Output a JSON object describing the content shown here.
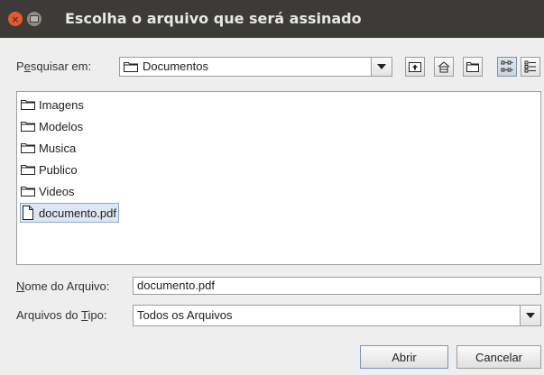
{
  "window": {
    "title": "Escolha o arquivo que será assinado"
  },
  "toolbar": {
    "look_in_label_u": "e",
    "look_in_label_pre": "P",
    "look_in_label_post": "squisar em:",
    "look_in_value": "Documentos",
    "buttons": [
      "up-folder",
      "home",
      "new-folder",
      "list-view",
      "details-view"
    ]
  },
  "files": [
    {
      "name": "Imagens",
      "type": "folder"
    },
    {
      "name": "Modelos",
      "type": "folder"
    },
    {
      "name": "Musica",
      "type": "folder"
    },
    {
      "name": "Publico",
      "type": "folder"
    },
    {
      "name": "Videos",
      "type": "folder"
    },
    {
      "name": "documento.pdf",
      "type": "file",
      "selected": true
    }
  ],
  "filename": {
    "label_u": "N",
    "label_post": "ome do Arquivo:",
    "value": "documento.pdf"
  },
  "filetype": {
    "label_pre": "Arquivos do ",
    "label_u": "T",
    "label_post": "ipo:",
    "value": "Todos os Arquivos"
  },
  "actions": {
    "open": "Abrir",
    "cancel": "Cancelar"
  }
}
